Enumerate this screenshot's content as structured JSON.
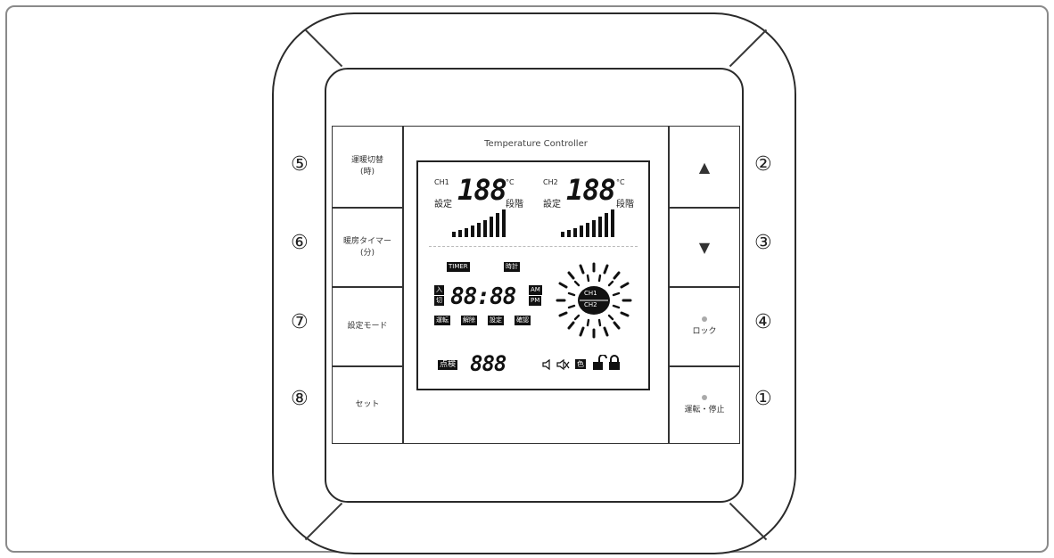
{
  "panel_title": "Temperature Controller",
  "buttons": {
    "left": [
      {
        "line1": "運暖切替",
        "line2": "(時)"
      },
      {
        "line1": "暖房タイマー",
        "line2": "(分)"
      },
      {
        "line1": "設定モード",
        "line2": ""
      },
      {
        "line1": "セット",
        "line2": ""
      }
    ],
    "right": [
      {
        "label": "▲"
      },
      {
        "label": "▼"
      },
      {
        "label": "ロック"
      },
      {
        "label": "運転・停止"
      }
    ]
  },
  "callouts": {
    "n1": "①",
    "n2": "②",
    "n3": "③",
    "n4": "④",
    "n5": "⑤",
    "n6": "⑥",
    "n7": "⑦",
    "n8": "⑧"
  },
  "lcd": {
    "ch1": {
      "channel": "CH1",
      "value": "188",
      "unit": "°C",
      "left_label": "設定",
      "right_label": "段階"
    },
    "ch2": {
      "channel": "CH2",
      "value": "188",
      "unit": "°C",
      "left_label": "設定",
      "right_label": "段階"
    },
    "timer_tag": "TIMER",
    "clock_tag": "時計",
    "on_tag": "入",
    "off_tag": "切",
    "time": "88:88",
    "am": "AM",
    "pm": "PM",
    "mode_tags": [
      "運転",
      "解除",
      "設定",
      "確認"
    ],
    "dial_ch1": "CH1",
    "dial_ch2": "CH2",
    "check_tag": "点検",
    "check_value": "888",
    "color_tag": "色"
  }
}
